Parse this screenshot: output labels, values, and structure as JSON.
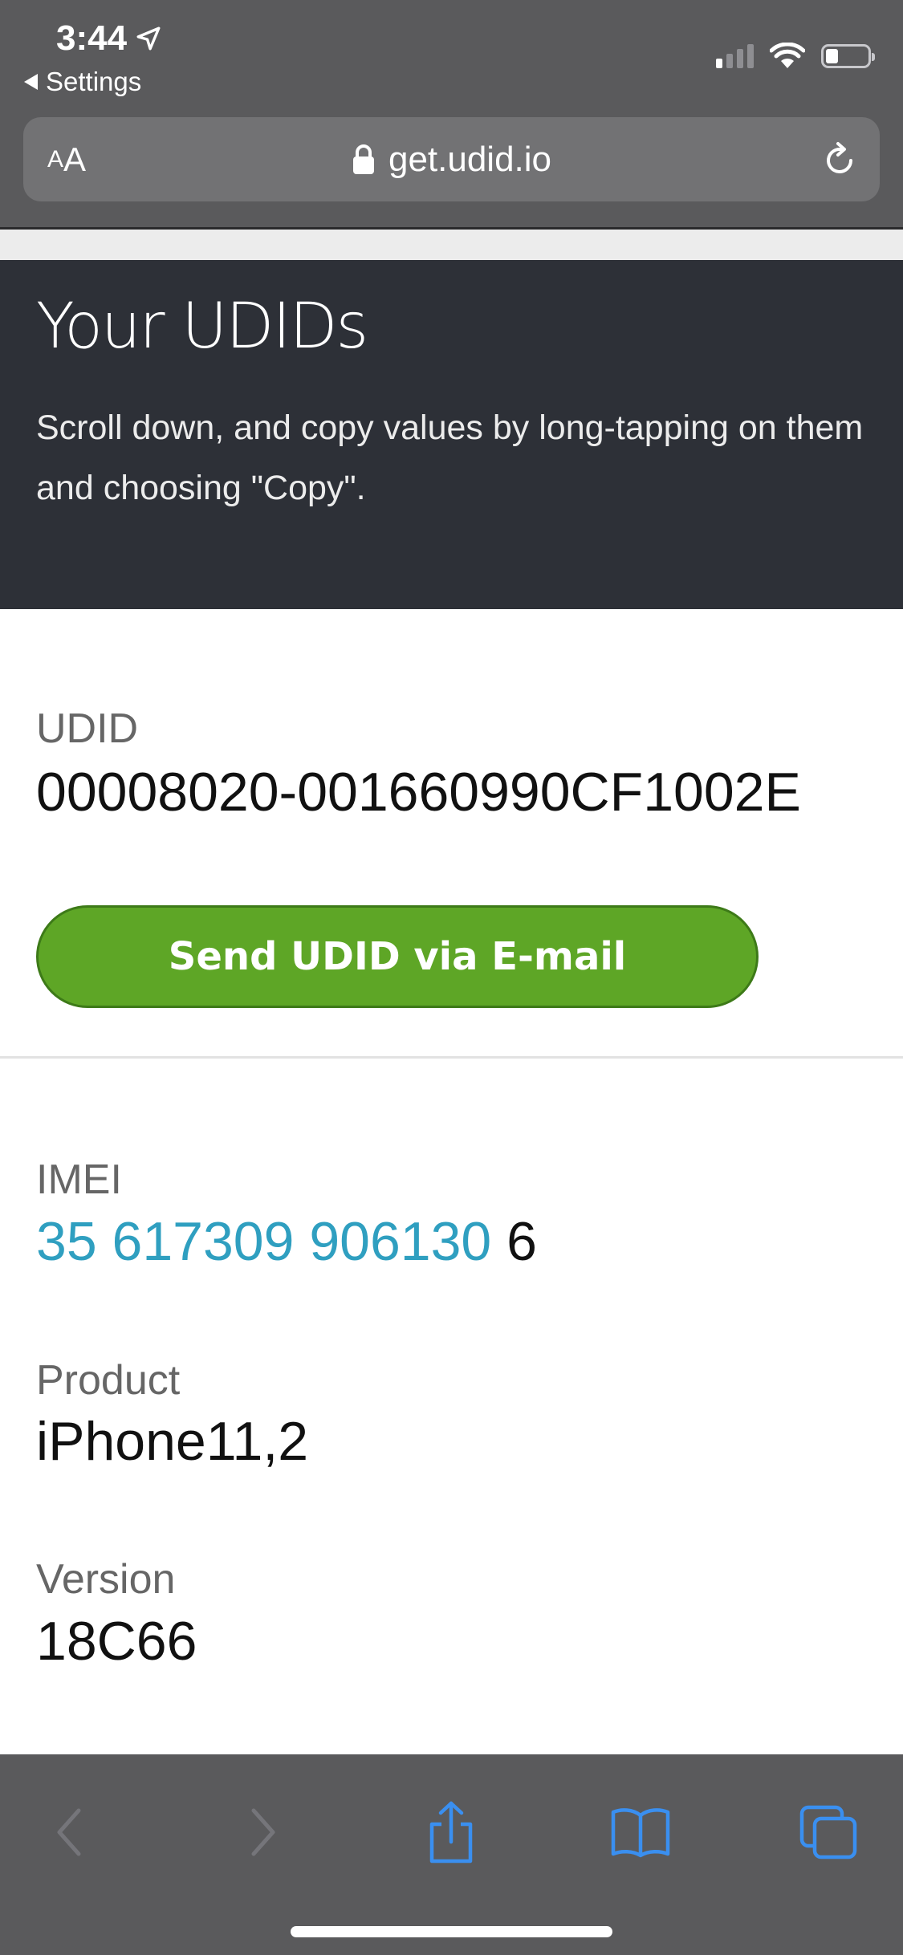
{
  "status_bar": {
    "time": "3:44",
    "back_app": "Settings",
    "signal_bars_active": 1,
    "signal_bars_total": 4,
    "battery_level": 0.3
  },
  "browser": {
    "text_size_small": "A",
    "text_size_big": "A",
    "url": "get.udid.io"
  },
  "hero": {
    "title": "Your UDIDs",
    "subtitle": "Scroll down, and copy values by long-tapping on them and choosing \"Copy\"."
  },
  "udid": {
    "label": "UDID",
    "value": "00008020-001660990CF1002E"
  },
  "send_button": {
    "label": "Send UDID via E-mail"
  },
  "imei": {
    "label": "IMEI",
    "value_link": "35 617309 906130",
    "value_suffix": " 6"
  },
  "product": {
    "label": "Product",
    "value": "iPhone11,2"
  },
  "version": {
    "label": "Version",
    "value": "18C66"
  },
  "toolbar": {
    "icons": [
      "back-icon",
      "forward-icon",
      "share-icon",
      "bookmarks-icon",
      "tabs-icon"
    ]
  },
  "colors": {
    "chrome": "#5a5a5c",
    "hero_bg": "#2d3037",
    "button_green": "#5ea626",
    "link_blue": "#2f9fc0",
    "toolbar_icon_blue": "#3a8ff0"
  }
}
